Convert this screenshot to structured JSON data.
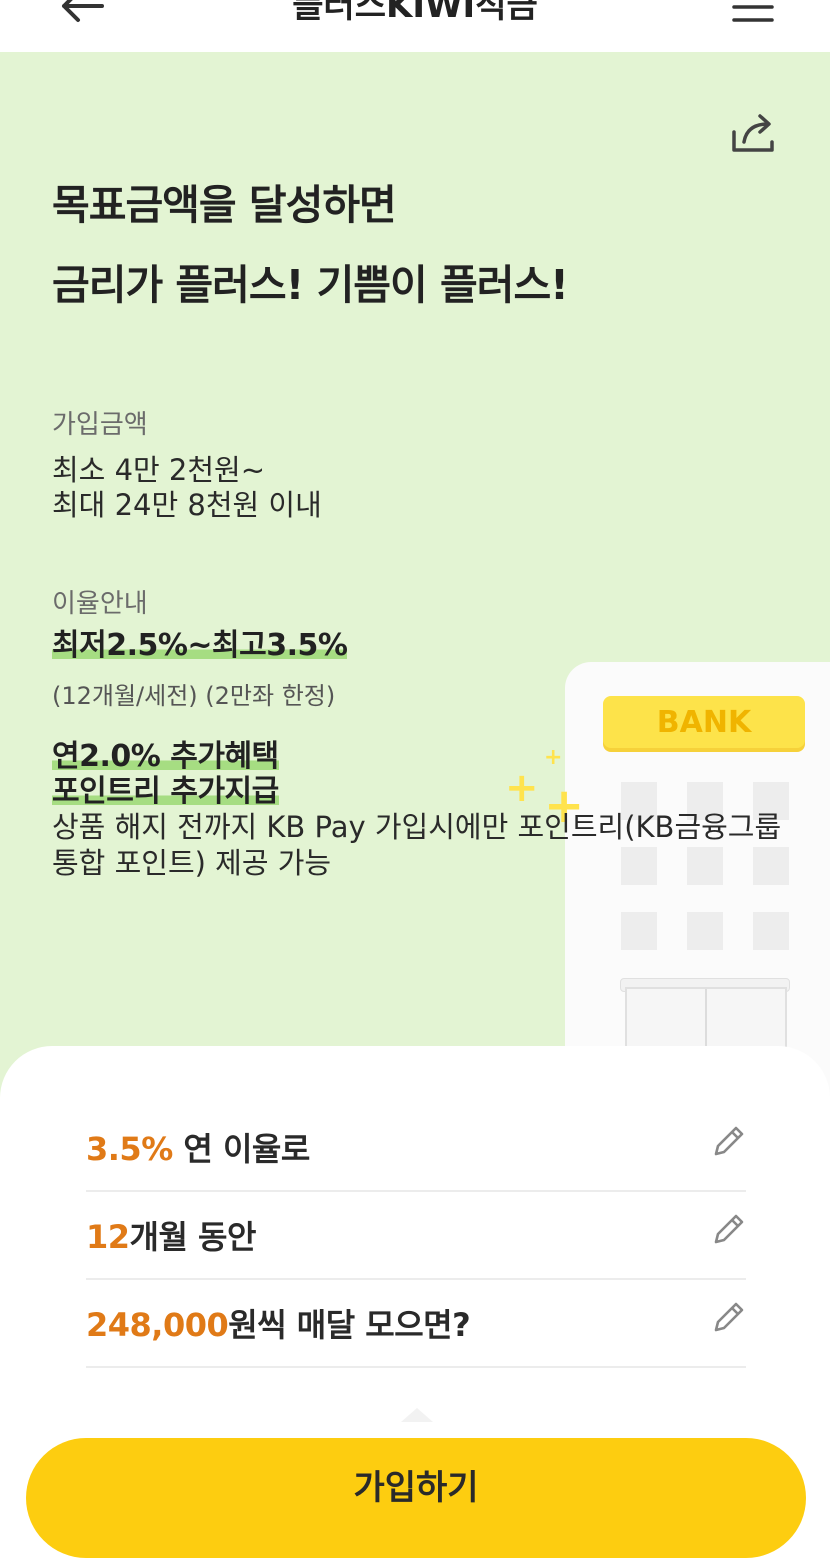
{
  "header": {
    "title": "플러스KIWI적금"
  },
  "hero": {
    "headline_line1": "목표금액을 달성하면",
    "headline_line2": "금리가 플러스! 기쁨이 플러스!",
    "amount_label": "가입금액",
    "amount_line1": "최소 4만 2천원~",
    "amount_line2": "최대 24만 8천원 이내",
    "rate_label": "이율안내",
    "rate_highlight": "최저2.5%~최고3.5%",
    "rate_note": "(12개월/세전) (2만좌 한정)",
    "benefit_line1": "연2.0% 추가혜택",
    "benefit_line2": "포인트리 추가지급",
    "benefit_desc": "상품 해지 전까지 KB Pay 가입시에만 포인트리(KB금융그룹 통합 포인트) 제공 가능",
    "bank_sign": "BANK"
  },
  "calculator": {
    "rows": [
      {
        "value": "3.5%",
        "suffix": " 연 이율로"
      },
      {
        "value": "12",
        "suffix": "개월 동안"
      },
      {
        "value": "248,000",
        "suffix": "원씩 매달 모으면?"
      }
    ]
  },
  "cta": {
    "label": "가입하기"
  },
  "colors": {
    "hero_bg": "#e3f4d3",
    "highlight": "#a6dd82",
    "accent_value": "#e07a17",
    "cta_bg": "#fdcd10"
  },
  "icons": [
    "arrow-left-icon",
    "hamburger-menu-icon",
    "share-icon",
    "pencil-icon"
  ]
}
